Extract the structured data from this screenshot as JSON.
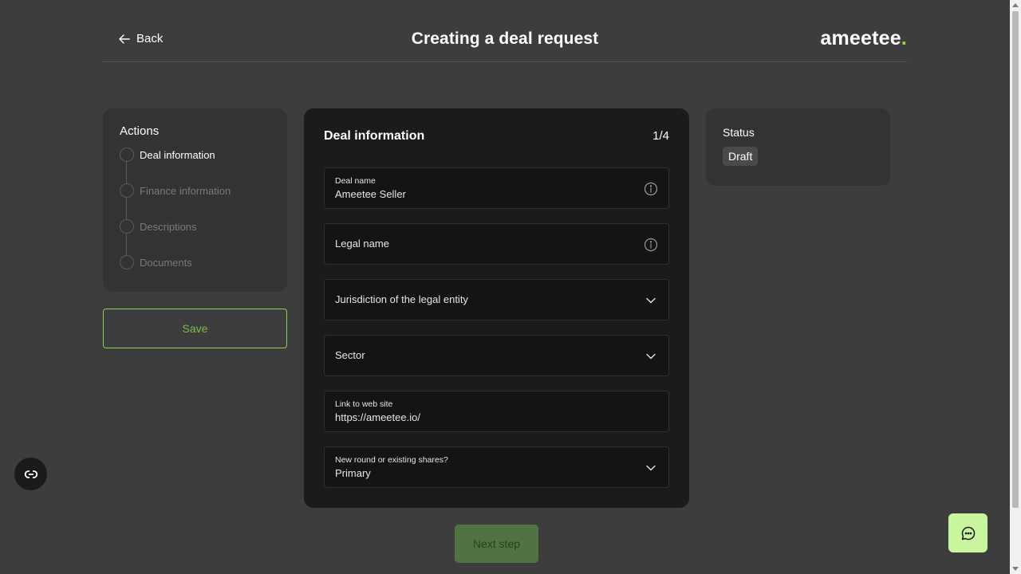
{
  "header": {
    "back_label": "Back",
    "title": "Creating a deal request",
    "logo_text": "ameetee",
    "logo_dot": "."
  },
  "actions": {
    "title": "Actions",
    "steps": [
      {
        "label": "Deal information",
        "active": true
      },
      {
        "label": "Finance information",
        "active": false
      },
      {
        "label": "Descriptions",
        "active": false
      },
      {
        "label": "Documents",
        "active": false
      }
    ],
    "save_label": "Save"
  },
  "form": {
    "title": "Deal information",
    "counter": "1/4",
    "fields": [
      {
        "label": "Deal name",
        "value": "Ameetee Seller",
        "icon": "info-icon"
      },
      {
        "label": "Legal name",
        "value": "",
        "icon": "info-icon"
      },
      {
        "label": "Jurisdiction of the legal entity",
        "value": "",
        "icon": "chevron-down-icon"
      },
      {
        "label": "Sector",
        "value": "",
        "icon": "chevron-down-icon"
      },
      {
        "label": "Link to web site",
        "value": "https://ameetee.io/",
        "icon": ""
      },
      {
        "label": "New round or existing shares?",
        "value": "Primary",
        "icon": "chevron-down-icon"
      }
    ],
    "next_label": "Next step"
  },
  "status": {
    "title": "Status",
    "value": "Draft"
  },
  "colors": {
    "background": "#3d3d3d",
    "panel": "#333333",
    "form_panel": "#1b1b1b",
    "accent_green": "#8fcd55",
    "next_button": "#4f7441",
    "chat_button": "#c9f59e"
  }
}
